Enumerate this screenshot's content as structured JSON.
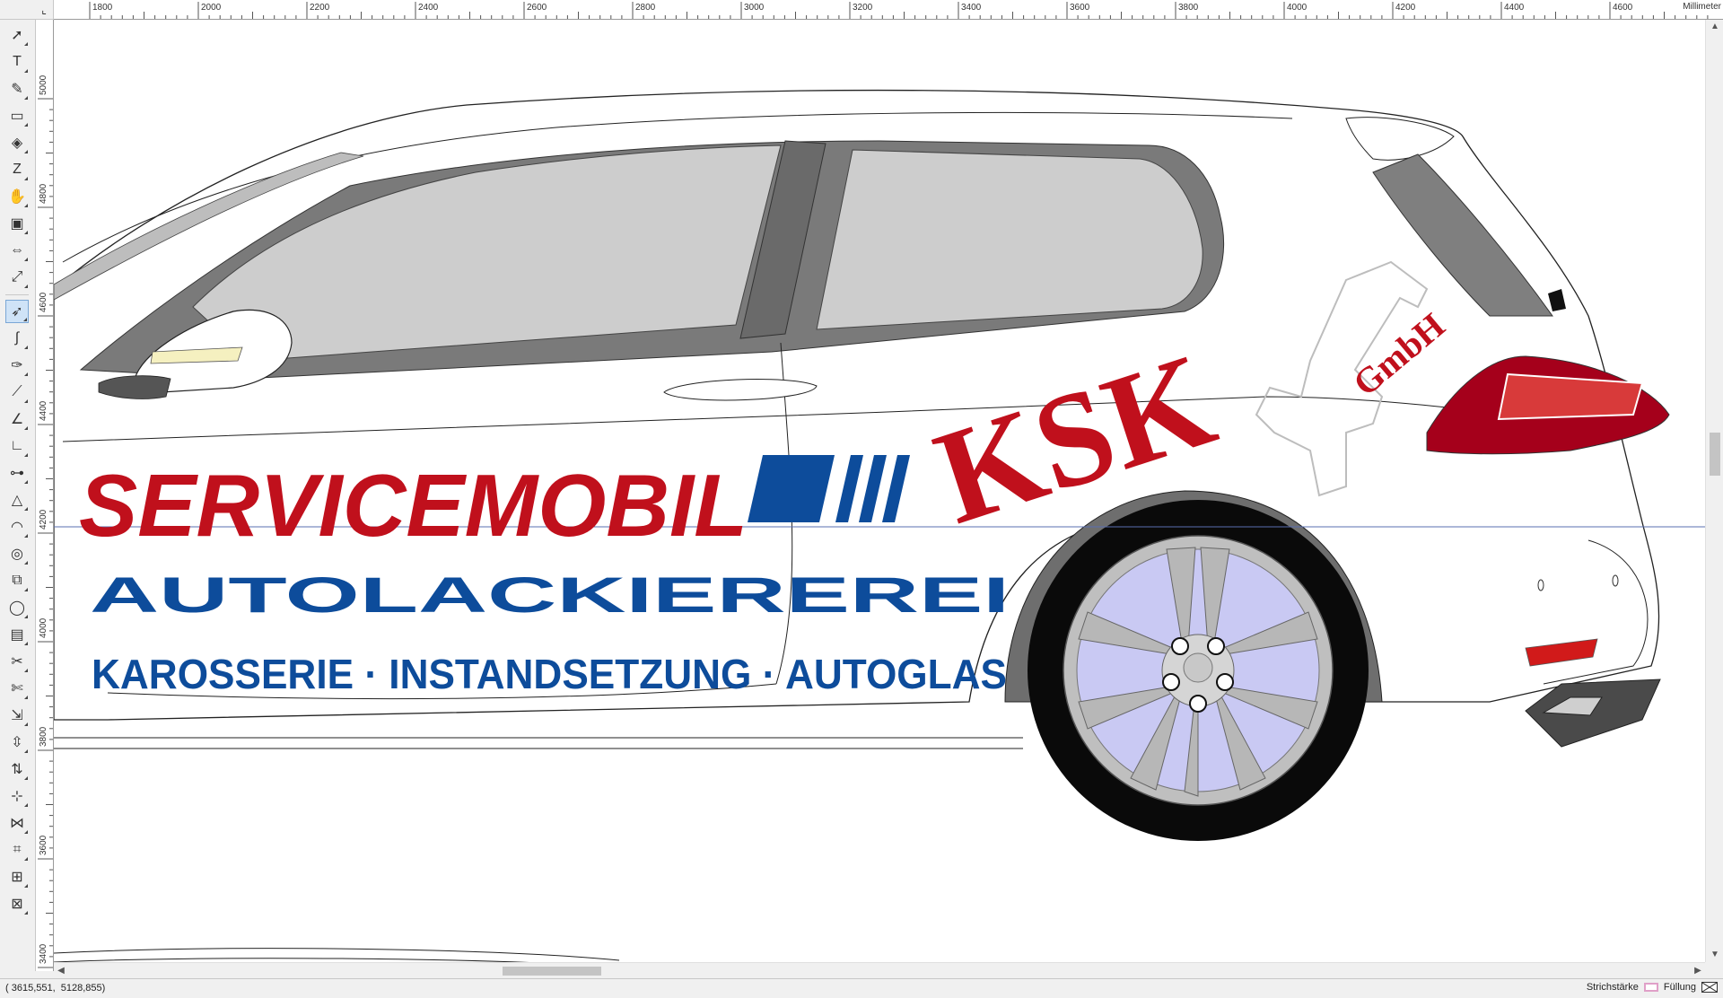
{
  "ruler": {
    "unit_label": "Millimeter",
    "h_ticks": [
      "1800",
      "2000",
      "2200",
      "2400",
      "2600",
      "2800",
      "3000",
      "3200",
      "3400",
      "3600",
      "3800",
      "4000",
      "4200",
      "4400",
      "4600"
    ],
    "v_ticks": [
      "5000",
      "4800",
      "4600",
      "4400",
      "4200",
      "4000",
      "3800",
      "3600",
      "3400"
    ]
  },
  "toolbox": {
    "tools": [
      {
        "name": "pick-tool",
        "glyph": "➚",
        "active": false
      },
      {
        "name": "text-tool",
        "glyph": "T",
        "active": false
      },
      {
        "name": "freehand-tool",
        "glyph": "✎",
        "active": false
      },
      {
        "name": "rectangle-tool",
        "glyph": "▭",
        "active": false
      },
      {
        "name": "interactive-fill-tool",
        "glyph": "◈",
        "active": false
      },
      {
        "name": "fountain-fill-tool",
        "glyph": "Z",
        "active": false
      },
      {
        "name": "smear-tool",
        "glyph": "✋",
        "active": false
      },
      {
        "name": "shape-tool",
        "glyph": "▣",
        "active": false
      },
      {
        "name": "dimension-tool",
        "glyph": "⇔",
        "active": false
      },
      {
        "name": "eyedropper-tool",
        "glyph": "⤢",
        "active": false
      },
      {
        "name": "node-edit-tool",
        "glyph": "➶",
        "active": true
      },
      {
        "name": "bezier-tool",
        "glyph": "∫",
        "active": false
      },
      {
        "name": "pen-tool",
        "glyph": "✑",
        "active": false
      },
      {
        "name": "polyline-tool",
        "glyph": "⟋",
        "active": false
      },
      {
        "name": "angle-tool",
        "glyph": "∠",
        "active": false
      },
      {
        "name": "corner-tool",
        "glyph": "∟",
        "active": false
      },
      {
        "name": "connector-tool",
        "glyph": "⊶",
        "active": false
      },
      {
        "name": "triangle-tool",
        "glyph": "△",
        "active": false
      },
      {
        "name": "arc-tool",
        "glyph": "◠",
        "active": false
      },
      {
        "name": "spiral-tool",
        "glyph": "◎",
        "active": false
      },
      {
        "name": "blend-tool",
        "glyph": "⧉",
        "active": false
      },
      {
        "name": "contour-tool",
        "glyph": "◯",
        "active": false
      },
      {
        "name": "envelope-tool",
        "glyph": "▤",
        "active": false
      },
      {
        "name": "extrude-tool",
        "glyph": "✂",
        "active": false
      },
      {
        "name": "crop-tool",
        "glyph": "✄",
        "active": false
      },
      {
        "name": "transform-tool",
        "glyph": "⇲",
        "active": false
      },
      {
        "name": "align-tool",
        "glyph": "⇳",
        "active": false
      },
      {
        "name": "distribute-tool",
        "glyph": "⇅",
        "active": false
      },
      {
        "name": "weld-tool",
        "glyph": "⊹",
        "active": false
      },
      {
        "name": "snap-tool",
        "glyph": "⋈",
        "active": false
      },
      {
        "name": "mesh-tool",
        "glyph": "⌗",
        "active": false
      },
      {
        "name": "zoom-tool",
        "glyph": "⊞",
        "active": false
      },
      {
        "name": "hand-tool",
        "glyph": "⊠",
        "active": false
      }
    ]
  },
  "canvas": {
    "headline": "SERVICEMOBIL",
    "brand": "KSK",
    "brand_suffix": "GmbH",
    "subline": "AUTOLACKIEREREI",
    "services": "KAROSSERIE · INSTANDSETZUNG · AUTOGLAS",
    "colors": {
      "red": "#c0101c",
      "blue": "#0d4c9b",
      "glass": "#cdcdcd",
      "rim_accent": "#c9c9f3",
      "tail": "#a5001b"
    }
  },
  "status": {
    "coords": "( 3615,551,  5128,855)",
    "stroke_label": "Strichstärke",
    "fill_label": "Füllung"
  }
}
